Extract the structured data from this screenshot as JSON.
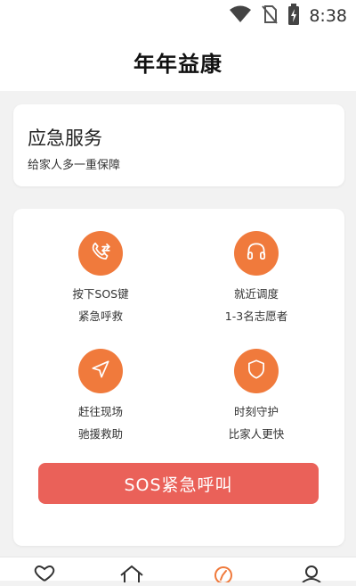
{
  "status_bar": {
    "time": "8:38",
    "icons": [
      "wifi-icon",
      "no-sim-icon",
      "battery-icon"
    ]
  },
  "header": {
    "title": "年年益康"
  },
  "service_card": {
    "title": "应急服务",
    "subtitle": "给家人多一重保障"
  },
  "features": [
    {
      "icon": "phone-forward-icon",
      "line1": "按下SOS键",
      "line2": "紧急呼救"
    },
    {
      "icon": "headset-icon",
      "line1": "就近调度",
      "line2": "1-3名志愿者"
    },
    {
      "icon": "navigation-icon",
      "line1": "赶往现场",
      "line2": "驰援救助"
    },
    {
      "icon": "shield-icon",
      "line1": "时刻守护",
      "line2": "比家人更快"
    }
  ],
  "sos_button": {
    "label": "SOS紧急呼叫"
  },
  "tabbar": {
    "icons": [
      "heart-icon",
      "home-icon",
      "compass-icon",
      "profile-icon"
    ]
  },
  "colors": {
    "accent_orange": "#f07a3c",
    "sos_red": "#ea6159",
    "background": "#f2f2f2"
  }
}
